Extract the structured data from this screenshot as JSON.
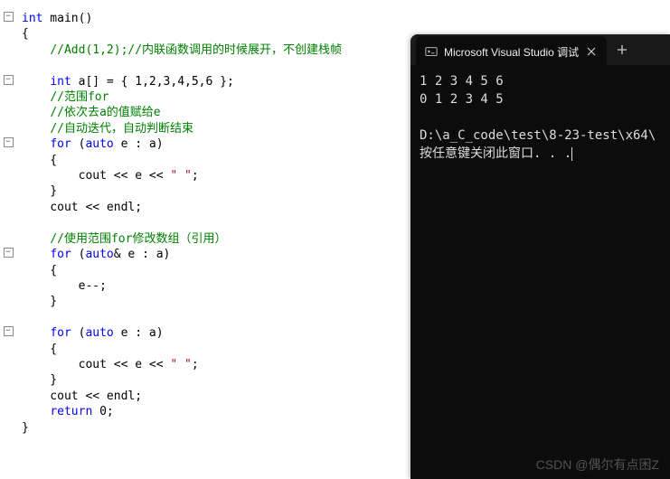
{
  "code": {
    "lines": [
      {
        "type": "line",
        "parts": [
          {
            "cls": "type",
            "t": "int"
          },
          {
            "cls": "punc",
            "t": " main()"
          }
        ]
      },
      {
        "type": "line",
        "parts": [
          {
            "cls": "punc",
            "t": "{"
          }
        ]
      },
      {
        "type": "line",
        "parts": [
          {
            "cls": "punc",
            "t": "    "
          },
          {
            "cls": "cmt",
            "t": "//Add(1,2);//内联函数调用的时候展开，不创建栈帧"
          }
        ]
      },
      {
        "type": "blank"
      },
      {
        "type": "line",
        "parts": [
          {
            "cls": "punc",
            "t": "    "
          },
          {
            "cls": "type",
            "t": "int"
          },
          {
            "cls": "punc",
            "t": " a[] = { 1,2,3,4,5,6 };"
          }
        ]
      },
      {
        "type": "line",
        "parts": [
          {
            "cls": "punc",
            "t": "    "
          },
          {
            "cls": "cmt",
            "t": "//范围for"
          }
        ]
      },
      {
        "type": "line",
        "parts": [
          {
            "cls": "punc",
            "t": "    "
          },
          {
            "cls": "cmt",
            "t": "//依次去a的值赋给e"
          }
        ]
      },
      {
        "type": "line",
        "parts": [
          {
            "cls": "punc",
            "t": "    "
          },
          {
            "cls": "cmt",
            "t": "//自动迭代，自动判断结束"
          }
        ]
      },
      {
        "type": "line",
        "parts": [
          {
            "cls": "punc",
            "t": "    "
          },
          {
            "cls": "kw",
            "t": "for"
          },
          {
            "cls": "punc",
            "t": " ("
          },
          {
            "cls": "kw",
            "t": "auto"
          },
          {
            "cls": "punc",
            "t": " e : a)"
          }
        ]
      },
      {
        "type": "line",
        "parts": [
          {
            "cls": "punc",
            "t": "    {"
          }
        ]
      },
      {
        "type": "line",
        "parts": [
          {
            "cls": "punc",
            "t": "        cout << e << "
          },
          {
            "cls": "str",
            "t": "\" \""
          },
          {
            "cls": "punc",
            "t": ";"
          }
        ]
      },
      {
        "type": "line",
        "parts": [
          {
            "cls": "punc",
            "t": "    }"
          }
        ]
      },
      {
        "type": "line",
        "parts": [
          {
            "cls": "punc",
            "t": "    cout << endl;"
          }
        ]
      },
      {
        "type": "blank"
      },
      {
        "type": "line",
        "parts": [
          {
            "cls": "punc",
            "t": "    "
          },
          {
            "cls": "cmt",
            "t": "//使用范围for修改数组（引用）"
          }
        ]
      },
      {
        "type": "line",
        "parts": [
          {
            "cls": "punc",
            "t": "    "
          },
          {
            "cls": "kw",
            "t": "for"
          },
          {
            "cls": "punc",
            "t": " ("
          },
          {
            "cls": "kw",
            "t": "auto"
          },
          {
            "cls": "punc",
            "t": "& e : a)"
          }
        ]
      },
      {
        "type": "line",
        "parts": [
          {
            "cls": "punc",
            "t": "    {"
          }
        ]
      },
      {
        "type": "line",
        "parts": [
          {
            "cls": "punc",
            "t": "        e--;"
          }
        ]
      },
      {
        "type": "line",
        "parts": [
          {
            "cls": "punc",
            "t": "    }"
          }
        ]
      },
      {
        "type": "blank"
      },
      {
        "type": "line",
        "parts": [
          {
            "cls": "punc",
            "t": "    "
          },
          {
            "cls": "kw",
            "t": "for"
          },
          {
            "cls": "punc",
            "t": " ("
          },
          {
            "cls": "kw",
            "t": "auto"
          },
          {
            "cls": "punc",
            "t": " e : a)"
          }
        ]
      },
      {
        "type": "line",
        "parts": [
          {
            "cls": "punc",
            "t": "    {"
          }
        ]
      },
      {
        "type": "line",
        "parts": [
          {
            "cls": "punc",
            "t": "        cout << e << "
          },
          {
            "cls": "str",
            "t": "\" \""
          },
          {
            "cls": "punc",
            "t": ";"
          }
        ]
      },
      {
        "type": "line",
        "parts": [
          {
            "cls": "punc",
            "t": "    }"
          }
        ]
      },
      {
        "type": "line",
        "parts": [
          {
            "cls": "punc",
            "t": "    cout << endl;"
          }
        ]
      },
      {
        "type": "line",
        "parts": [
          {
            "cls": "punc",
            "t": "    "
          },
          {
            "cls": "kw",
            "t": "return"
          },
          {
            "cls": "punc",
            "t": " 0;"
          }
        ]
      },
      {
        "type": "line",
        "parts": [
          {
            "cls": "punc",
            "t": "}"
          }
        ]
      }
    ],
    "folds": [
      0,
      4,
      8,
      15,
      20
    ]
  },
  "terminal": {
    "tab_title": "Microsoft Visual Studio 调试",
    "output": [
      "1 2 3 4 5 6",
      "0 1 2 3 4 5",
      "",
      "D:\\a_C_code\\test\\8-23-test\\x64\\",
      "按任意键关闭此窗口. . ."
    ]
  },
  "watermark": "CSDN @偶尔有点困Z"
}
